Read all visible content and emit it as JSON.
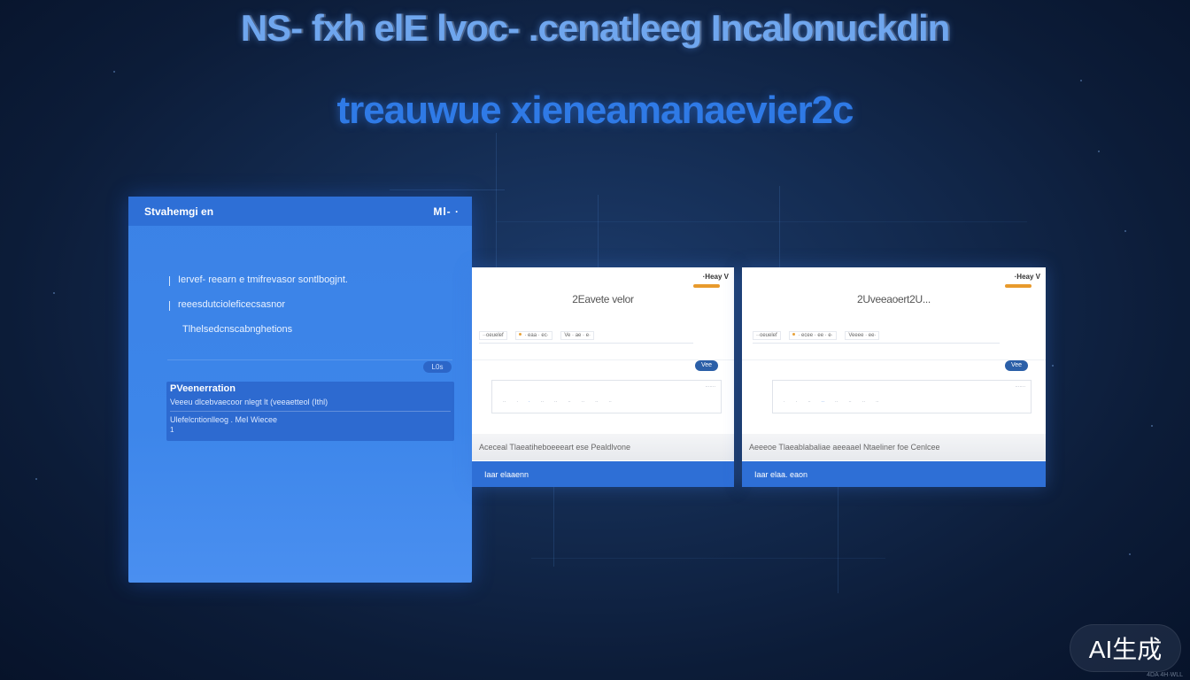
{
  "headline": {
    "line1": "NS- fxh elE lvoc- .cenatleeg Incalonuckdin",
    "line2": "treauwue xieneamanaevier2c"
  },
  "left_panel": {
    "title": "Stvahemgi en",
    "header_right": "Ml- ·",
    "bullets": [
      "Iervef- reearn e tmifrevasor sontlbogjnt.",
      "reeesdutcioleficecsasnor",
      "Tlhelsedcnscabnghetions"
    ],
    "pill": "L0s",
    "info": {
      "title": "PVeenerration",
      "line1": "Veeeu dlcebvaecoor nlegt lt (veeaetteol (Ithl)",
      "line2": "Ulefelcntionlleog . MeI Wiecee",
      "line3": "1"
    }
  },
  "cards": [
    {
      "badge": "·Heay V",
      "title": "2Eavete velor",
      "row_items": [
        "··oeuelef",
        "· eaa · ec·",
        "Ve · ae · e·"
      ],
      "pill": "Vee",
      "ticks": [
        "··",
        "·",
        "·",
        "··",
        "··",
        "··",
        "··",
        "··",
        "··"
      ],
      "chart_corner": "·······",
      "caption": "Aceceal Tlaeatiheboeeeart ese Pealdlvone",
      "footer": "Iaar elaaenn"
    },
    {
      "badge": "·Heay V",
      "title": "2Uveeaoert2U...",
      "row_items": [
        "··oeuelef",
        "· ecee · ee · e·",
        "Veeee · ee·"
      ],
      "pill": "Vee",
      "ticks": [
        "·",
        "·",
        "··",
        "··",
        "··",
        "··",
        "··",
        "··"
      ],
      "chart_corner": "·······",
      "caption": "Aeeeoe Tlaeablabaliae aeeaael Ntaeliner foe Cenlcee",
      "footer": "Iaar elaa. eaon"
    }
  ],
  "watermark": "AI生成",
  "corner_text": "4DA 4H·WLL"
}
